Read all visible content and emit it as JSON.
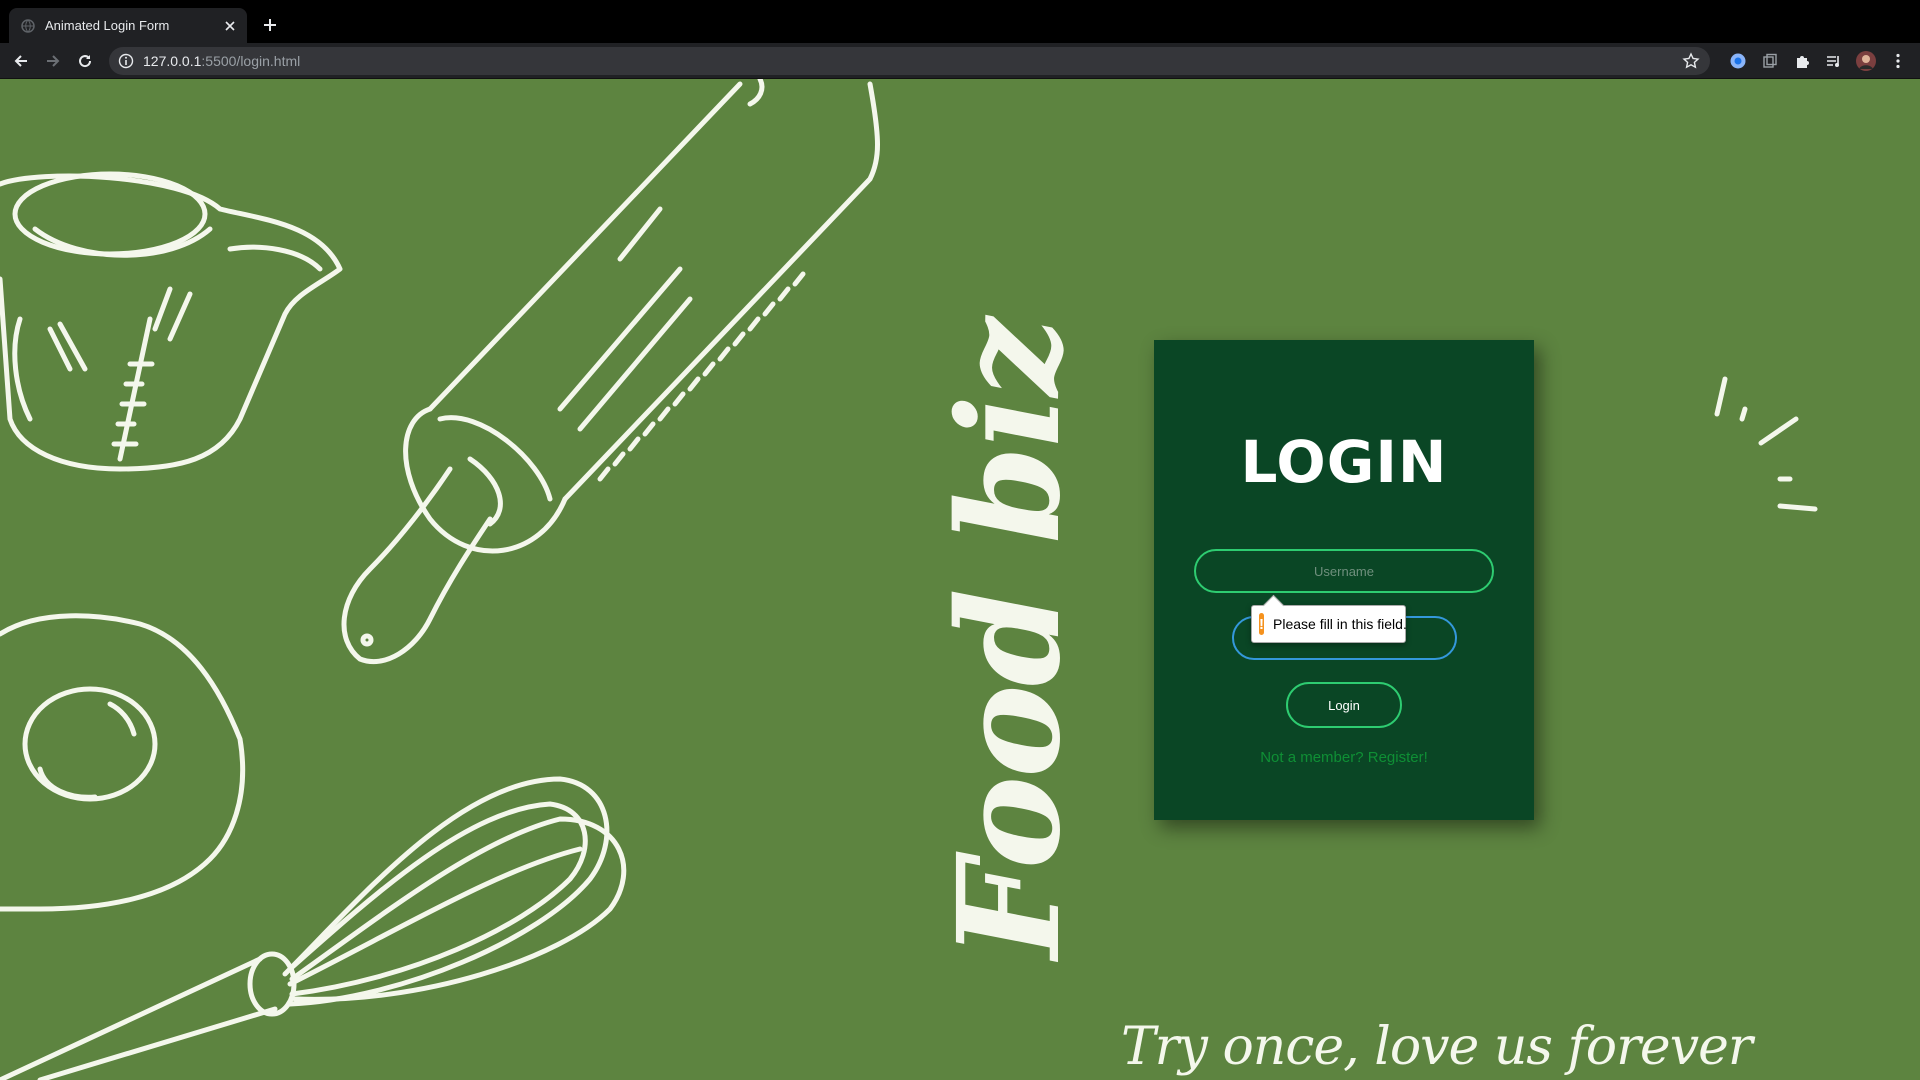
{
  "browser": {
    "tab_title": "Animated Login Form",
    "url_host": "127.0.0.1",
    "url_rest": ":5500/login.html"
  },
  "page": {
    "brand": "Food biz",
    "tagline": "Try once, love us forever"
  },
  "login": {
    "title": "LOGIN",
    "username_placeholder": "Username",
    "password_placeholder": "",
    "button_label": "Login",
    "register_text": "Not a member? Register!"
  },
  "validation": {
    "message": "Please fill in this field.",
    "icon": "!"
  },
  "colors": {
    "background": "#5d8440",
    "card": "#0a4625",
    "accent_green": "#2ecc71",
    "focus_blue": "#3498db",
    "link": "#0f8f35",
    "warning": "#f5921e"
  }
}
